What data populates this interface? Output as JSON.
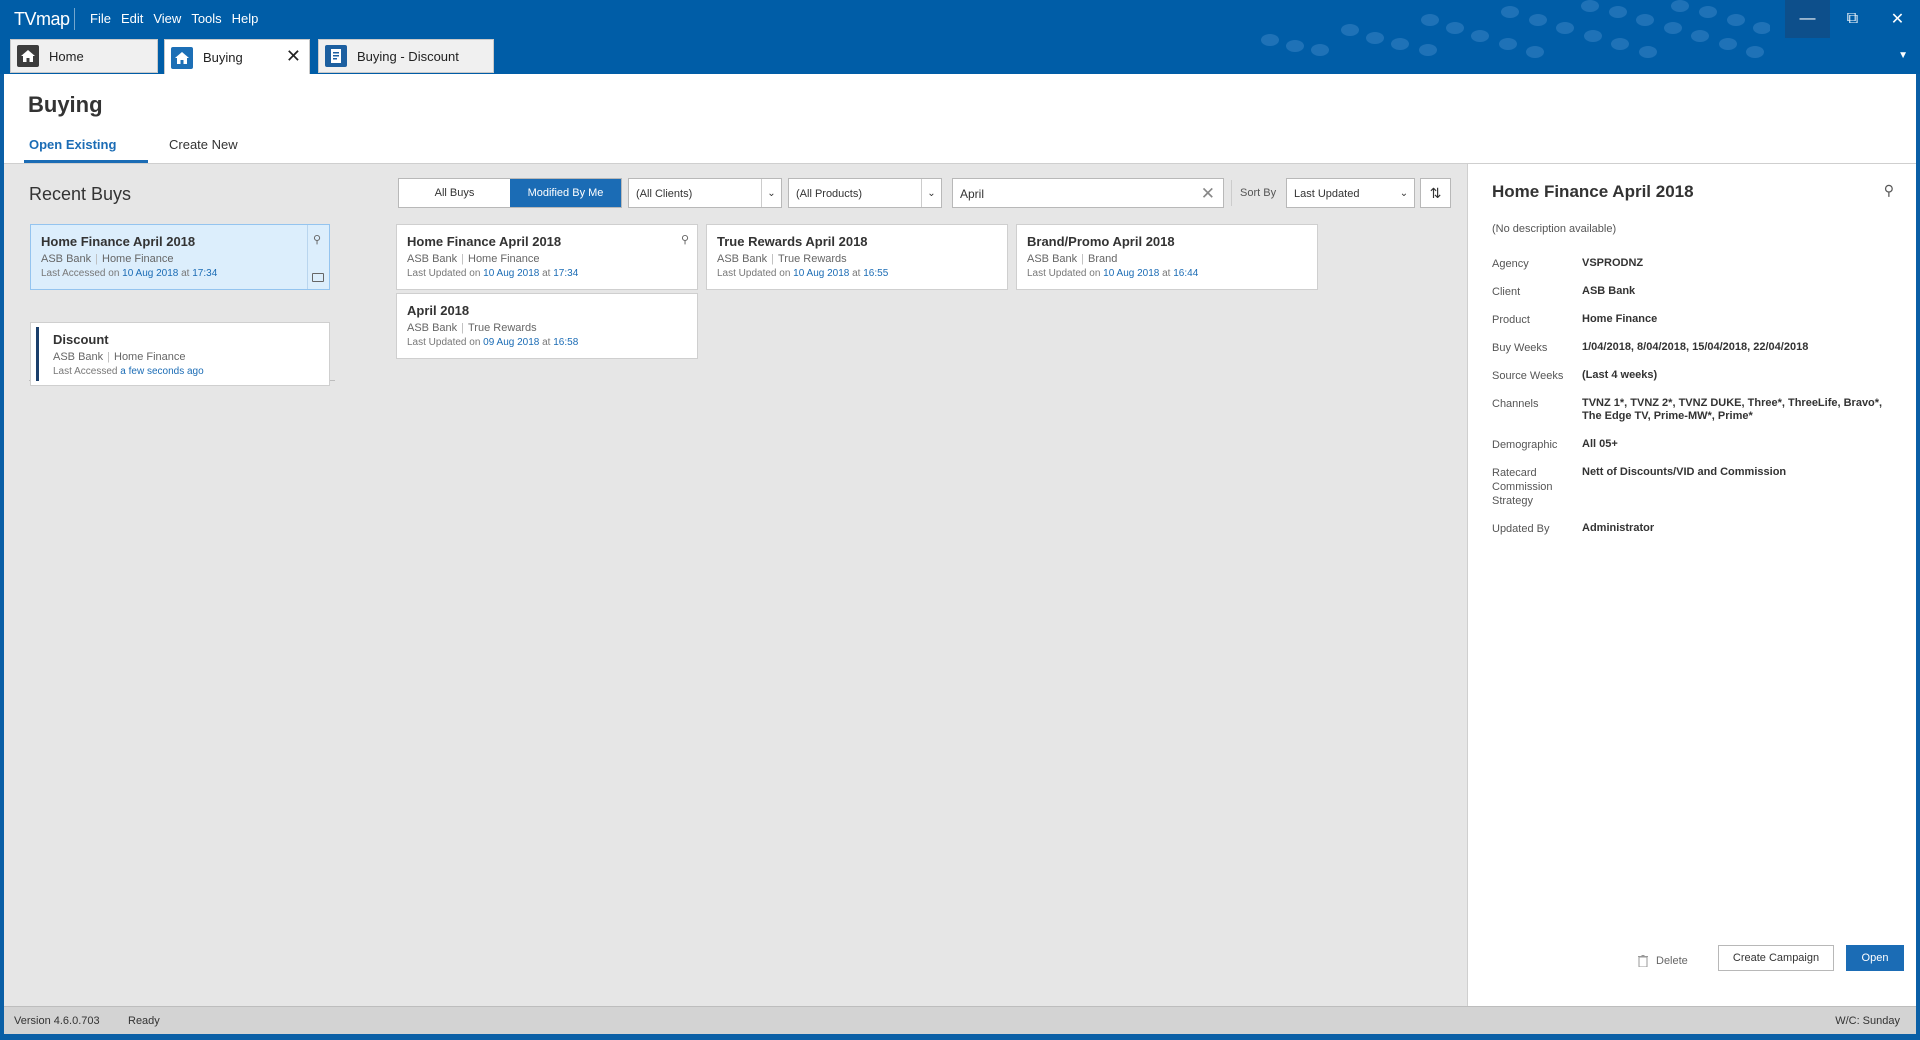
{
  "app": {
    "title": "TVmap"
  },
  "menu": [
    "File",
    "Edit",
    "View",
    "Tools",
    "Help"
  ],
  "tabs": [
    {
      "label": "Home",
      "icon": "home-icon"
    },
    {
      "label": "Buying",
      "icon": "home-icon",
      "active": true
    },
    {
      "label": "Buying - Discount",
      "icon": "document-icon"
    }
  ],
  "page": {
    "title": "Buying",
    "subtabs": [
      "Open Existing",
      "Create New"
    ]
  },
  "recent": {
    "title": "Recent Buys",
    "items": [
      {
        "title": "Home Finance April 2018",
        "client": "ASB Bank",
        "product": "Home Finance",
        "prefix": "Last Accessed on",
        "date": "10 Aug 2018",
        "at": "at",
        "time": "17:34"
      },
      {
        "title": "Discount",
        "client": "ASB Bank",
        "product": "Home Finance",
        "prefix": "Last Accessed",
        "relative": "a few seconds ago"
      }
    ]
  },
  "filters": {
    "segment": [
      "All Buys",
      "Modified By Me"
    ],
    "clients": "(All Clients)",
    "products": "(All Products)",
    "search": "April",
    "sort_label": "Sort By",
    "sort_value": "Last Updated"
  },
  "results": [
    {
      "title": "Home Finance April 2018",
      "client": "ASB Bank",
      "product": "Home Finance",
      "prefix": "Last Updated on",
      "date": "10 Aug 2018",
      "at": "at",
      "time": "17:34"
    },
    {
      "title": "True Rewards April 2018",
      "client": "ASB Bank",
      "product": "True Rewards",
      "prefix": "Last Updated on",
      "date": "10 Aug 2018",
      "at": "at",
      "time": "16:55"
    },
    {
      "title": "Brand/Promo April 2018",
      "client": "ASB Bank",
      "product": "Brand",
      "prefix": "Last Updated on",
      "date": "10 Aug 2018",
      "at": "at",
      "time": "16:44"
    },
    {
      "title": "April 2018",
      "client": "ASB Bank",
      "product": "True Rewards",
      "prefix": "Last Updated on",
      "date": "09 Aug 2018",
      "at": "at",
      "time": "16:58"
    }
  ],
  "detail": {
    "title": "Home Finance April 2018",
    "description": "(No description available)",
    "fields": [
      {
        "label": "Agency",
        "value": "VSPRODNZ"
      },
      {
        "label": "Client",
        "value": "ASB Bank"
      },
      {
        "label": "Product",
        "value": "Home Finance"
      },
      {
        "label": "Buy Weeks",
        "value": "1/04/2018, 8/04/2018, 15/04/2018, 22/04/2018"
      },
      {
        "label": "Source Weeks",
        "value": "(Last 4 weeks)"
      },
      {
        "label": "Channels",
        "value": "TVNZ 1*, TVNZ 2*, TVNZ DUKE, Three*, ThreeLife, Bravo*, The Edge TV, Prime-MW*, Prime*"
      },
      {
        "label": "Demographic",
        "value": "All 05+"
      },
      {
        "label": "Ratecard Commission Strategy",
        "value": "Nett of Discounts/VID and Commission"
      },
      {
        "label": "Updated By",
        "value": "Administrator"
      }
    ],
    "buttons": {
      "delete": "Delete",
      "create": "Create Campaign",
      "open": "Open"
    }
  },
  "status": {
    "version": "Version 4.6.0.703",
    "state": "Ready",
    "week": "W/C: Sunday"
  },
  "colors": {
    "titlebar": "#005da7",
    "accent": "#1b6cb5",
    "selected": "#dceefc"
  }
}
